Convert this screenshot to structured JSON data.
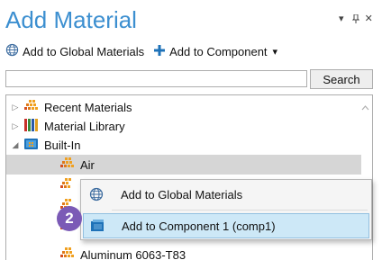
{
  "window": {
    "title": "Add Material",
    "dropdown_glyph": "▾",
    "pin_glyph": "⊥",
    "close_glyph": "✕"
  },
  "toolbar": {
    "add_global_label": "Add to Global Materials",
    "add_component_label": "Add to Component",
    "add_component_dropdown": "▾"
  },
  "search": {
    "value": "",
    "placeholder": "",
    "button_label": "Search"
  },
  "tree": {
    "items": [
      {
        "label": "Recent Materials",
        "icon": "recent-materials-icon",
        "expander": "▷"
      },
      {
        "label": "Material Library",
        "icon": "material-library-icon",
        "expander": "▷"
      },
      {
        "label": "Built-In",
        "icon": "built-in-folder-icon",
        "expander": "◢"
      },
      {
        "label": "Air",
        "icon": "material-icon",
        "selected": true
      },
      {
        "label": "Aluminum 6063-T83",
        "icon": "material-icon"
      }
    ]
  },
  "context_menu": {
    "items": [
      {
        "label": "Add to Global Materials",
        "icon": "globe-icon"
      },
      {
        "label": "Add to Component 1 (comp1)",
        "icon": "component-icon",
        "hover": true
      }
    ]
  },
  "callout": {
    "number": "2"
  },
  "colors": {
    "title": "#3c8fd0",
    "accent_blue": "#1e72b8",
    "material_orange": "#f0a020",
    "selection": "#d6d6d6",
    "menu_hover": "#cde8f7",
    "callout": "#7b5ab6"
  }
}
